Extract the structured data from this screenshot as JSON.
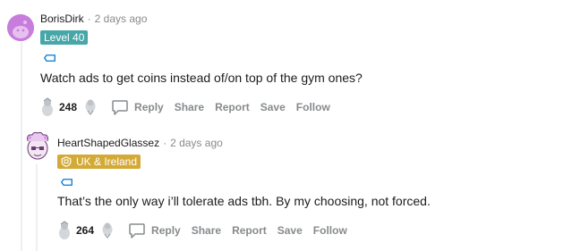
{
  "comments": [
    {
      "author": "BorisDirk",
      "separator": "·",
      "time": "2 days ago",
      "flair": "Level 40",
      "body": "Watch ads to get coins instead of/on top of the gym ones?",
      "score": "248",
      "actions": {
        "reply": "Reply",
        "share": "Share",
        "report": "Report",
        "save": "Save",
        "follow": "Follow"
      }
    },
    {
      "author": "HeartShapedGlassez",
      "separator": "·",
      "time": "2 days ago",
      "flair": "UK & Ireland",
      "body": "That’s the only way i’ll tolerate ads tbh. By my choosing, not forced.",
      "score": "264",
      "actions": {
        "reply": "Reply",
        "share": "Share",
        "report": "Report",
        "save": "Save",
        "follow": "Follow"
      }
    }
  ],
  "colors": {
    "level_flair": "#46a6a8",
    "region_flair": "#d4aa37",
    "muted_text": "#878a8c",
    "thread_line": "#edeff1",
    "avatar_purple": "#c77ddc"
  },
  "icons": [
    "tag-icon",
    "upvote-icon",
    "downvote-icon",
    "reply-icon",
    "shield-icon"
  ]
}
